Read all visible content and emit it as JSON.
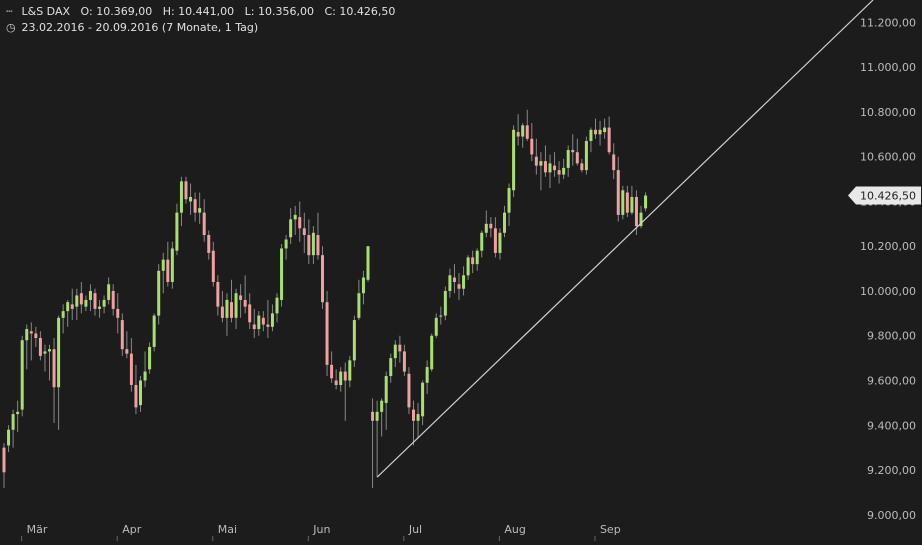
{
  "header": {
    "instrument": "L&S DAX",
    "open_label": "O:",
    "open": "10.369,00",
    "high_label": "H:",
    "high": "10.441,00",
    "low_label": "L:",
    "low": "10.356,00",
    "close_label": "C:",
    "close": "10.426,50",
    "date_range": "23.02.2016 - 20.09.2016 (7 Monate, 1 Tag)",
    "instrument_icon": "candlestick-icon",
    "range_icon": "clock-icon"
  },
  "colors": {
    "background": "#1c1c1c",
    "up": "#a8e070",
    "down": "#f0a0a0",
    "wick": "#888888",
    "trendline": "#d0d0d0",
    "axis_text": "#bbbbbb",
    "price_tag_bg": "#e8e8e8",
    "price_tag_text": "#222222"
  },
  "chart_data": {
    "type": "candlestick",
    "ylim": [
      8950,
      11300
    ],
    "y_ticks": [
      "9.000,00",
      "9.200,00",
      "9.400,00",
      "9.600,00",
      "9.800,00",
      "10.000,00",
      "10.200,00",
      "10.400,00",
      "10.600,00",
      "10.800,00",
      "11.000,00",
      "11.200,00"
    ],
    "y_tick_values": [
      9000,
      9200,
      9400,
      9600,
      9800,
      10000,
      10200,
      10400,
      10600,
      10800,
      11000,
      11200
    ],
    "x_ticks": [
      {
        "label": "Mär",
        "index": 3
      },
      {
        "label": "Apr",
        "index": 24
      },
      {
        "label": "Mai",
        "index": 45
      },
      {
        "label": "Jun",
        "index": 66
      },
      {
        "label": "Jul",
        "index": 87
      },
      {
        "label": "Aug",
        "index": 108
      },
      {
        "label": "Sep",
        "index": 129
      }
    ],
    "last_price_label": "10.426,50",
    "last_price": 10426.5,
    "trendline": {
      "from": {
        "index": 82,
        "value": 9168
      },
      "to": {
        "index": 191,
        "value": 11300
      }
    },
    "candles": [
      [
        9300,
        9320,
        9120,
        9190
      ],
      [
        9310,
        9400,
        9280,
        9380
      ],
      [
        9380,
        9470,
        9300,
        9450
      ],
      [
        9450,
        9510,
        9370,
        9460
      ],
      [
        9470,
        9800,
        9440,
        9780
      ],
      [
        9780,
        9850,
        9650,
        9830
      ],
      [
        9820,
        9860,
        9690,
        9810
      ],
      [
        9810,
        9840,
        9750,
        9790
      ],
      [
        9790,
        9820,
        9690,
        9710
      ],
      [
        9720,
        9760,
        9640,
        9730
      ],
      [
        9730,
        9760,
        9600,
        9740
      ],
      [
        9740,
        9790,
        9410,
        9570
      ],
      [
        9570,
        9890,
        9380,
        9880
      ],
      [
        9880,
        9940,
        9810,
        9910
      ],
      [
        9910,
        9960,
        9840,
        9950
      ],
      [
        9940,
        10010,
        9870,
        9920
      ],
      [
        9930,
        10010,
        9870,
        9980
      ],
      [
        9990,
        10040,
        9900,
        9940
      ],
      [
        9930,
        9980,
        9910,
        9960
      ],
      [
        9960,
        10030,
        9910,
        10000
      ],
      [
        9990,
        10010,
        9890,
        9920
      ],
      [
        9920,
        9960,
        9880,
        9930
      ],
      [
        9930,
        9980,
        9900,
        9960
      ],
      [
        9960,
        10060,
        9940,
        10030
      ],
      [
        10000,
        10030,
        9890,
        9920
      ],
      [
        9920,
        9990,
        9810,
        9880
      ],
      [
        9870,
        9900,
        9710,
        9740
      ],
      [
        9740,
        9820,
        9700,
        9720
      ],
      [
        9720,
        9790,
        9550,
        9580
      ],
      [
        9580,
        9670,
        9450,
        9480
      ],
      [
        9490,
        9620,
        9460,
        9600
      ],
      [
        9600,
        9730,
        9570,
        9640
      ],
      [
        9650,
        9770,
        9630,
        9750
      ],
      [
        9750,
        9900,
        9730,
        9890
      ],
      [
        9890,
        10120,
        9850,
        10090
      ],
      [
        10090,
        10170,
        9990,
        10140
      ],
      [
        10140,
        10220,
        10020,
        10040
      ],
      [
        10040,
        10220,
        10010,
        10190
      ],
      [
        10180,
        10390,
        10160,
        10350
      ],
      [
        10350,
        10510,
        10290,
        10490
      ],
      [
        10490,
        10510,
        10390,
        10410
      ],
      [
        10400,
        10480,
        10340,
        10420
      ],
      [
        10410,
        10440,
        10310,
        10350
      ],
      [
        10350,
        10440,
        10300,
        10370
      ],
      [
        10350,
        10410,
        10220,
        10250
      ],
      [
        10250,
        10270,
        10140,
        10170
      ],
      [
        10180,
        10220,
        10020,
        10040
      ],
      [
        10040,
        10070,
        9890,
        9930
      ],
      [
        9930,
        10000,
        9860,
        9880
      ],
      [
        9880,
        9990,
        9800,
        9960
      ],
      [
        9950,
        10050,
        9860,
        9880
      ],
      [
        9880,
        10010,
        9830,
        9990
      ],
      [
        9980,
        10030,
        9880,
        9960
      ],
      [
        9960,
        10070,
        9900,
        9930
      ],
      [
        9940,
        9990,
        9830,
        9860
      ],
      [
        9850,
        9920,
        9790,
        9830
      ],
      [
        9830,
        9910,
        9800,
        9890
      ],
      [
        9880,
        9910,
        9820,
        9850
      ],
      [
        9850,
        9960,
        9790,
        9840
      ],
      [
        9840,
        9940,
        9820,
        9900
      ],
      [
        9900,
        9990,
        9860,
        9970
      ],
      [
        9960,
        10210,
        9930,
        10190
      ],
      [
        10190,
        10250,
        10140,
        10230
      ],
      [
        10240,
        10370,
        10210,
        10320
      ],
      [
        10320,
        10380,
        10250,
        10340
      ],
      [
        10330,
        10400,
        10220,
        10280
      ],
      [
        10280,
        10350,
        10170,
        10250
      ],
      [
        10250,
        10320,
        10120,
        10160
      ],
      [
        10160,
        10290,
        10120,
        10260
      ],
      [
        10250,
        10350,
        10140,
        10160
      ],
      [
        10160,
        10200,
        9920,
        9950
      ],
      [
        9950,
        10000,
        9620,
        9670
      ],
      [
        9670,
        9730,
        9590,
        9610
      ],
      [
        9600,
        9650,
        9560,
        9580
      ],
      [
        9580,
        9660,
        9550,
        9640
      ],
      [
        9640,
        9680,
        9420,
        9600
      ],
      [
        9600,
        9710,
        9570,
        9690
      ],
      [
        9690,
        9890,
        9660,
        9870
      ],
      [
        9880,
        10050,
        9870,
        9990
      ],
      [
        9990,
        10090,
        9940,
        10060
      ],
      [
        10050,
        10200,
        10040,
        10200
      ],
      [
        9460,
        9520,
        9120,
        9420
      ],
      [
        9420,
        9510,
        9170,
        9460
      ],
      [
        9460,
        9520,
        9350,
        9510
      ],
      [
        9500,
        9640,
        9380,
        9620
      ],
      [
        9620,
        9720,
        9590,
        9700
      ],
      [
        9700,
        9780,
        9660,
        9760
      ],
      [
        9760,
        9800,
        9680,
        9730
      ],
      [
        9730,
        9760,
        9620,
        9640
      ],
      [
        9630,
        9660,
        9450,
        9480
      ],
      [
        9470,
        9510,
        9310,
        9420
      ],
      [
        9420,
        9500,
        9340,
        9450
      ],
      [
        9440,
        9600,
        9400,
        9590
      ],
      [
        9590,
        9690,
        9540,
        9660
      ],
      [
        9650,
        9810,
        9640,
        9800
      ],
      [
        9800,
        9900,
        9790,
        9880
      ],
      [
        9890,
        9930,
        9850,
        9890
      ],
      [
        9890,
        10020,
        9870,
        10000
      ],
      [
        10000,
        10100,
        9970,
        10070
      ],
      [
        10060,
        10120,
        9990,
        10040
      ],
      [
        10030,
        10080,
        9960,
        10010
      ],
      [
        10010,
        10110,
        9980,
        10070
      ],
      [
        10070,
        10160,
        10050,
        10150
      ],
      [
        10150,
        10180,
        10080,
        10120
      ],
      [
        10120,
        10190,
        10090,
        10180
      ],
      [
        10180,
        10270,
        10150,
        10260
      ],
      [
        10260,
        10360,
        10240,
        10300
      ],
      [
        10300,
        10330,
        10240,
        10280
      ],
      [
        10280,
        10330,
        10150,
        10170
      ],
      [
        10170,
        10280,
        10140,
        10260
      ],
      [
        10260,
        10380,
        10240,
        10350
      ],
      [
        10350,
        10480,
        10290,
        10460
      ],
      [
        10450,
        10740,
        10420,
        10720
      ],
      [
        10710,
        10790,
        10650,
        10690
      ],
      [
        10690,
        10750,
        10640,
        10740
      ],
      [
        10740,
        10810,
        10670,
        10680
      ],
      [
        10680,
        10750,
        10580,
        10610
      ],
      [
        10600,
        10680,
        10520,
        10560
      ],
      [
        10560,
        10620,
        10450,
        10580
      ],
      [
        10580,
        10650,
        10510,
        10530
      ],
      [
        10530,
        10610,
        10460,
        10570
      ],
      [
        10560,
        10620,
        10510,
        10540
      ],
      [
        10540,
        10580,
        10480,
        10520
      ],
      [
        10520,
        10590,
        10500,
        10550
      ],
      [
        10550,
        10650,
        10510,
        10630
      ],
      [
        10630,
        10700,
        10560,
        10620
      ],
      [
        10620,
        10680,
        10560,
        10570
      ],
      [
        10570,
        10590,
        10530,
        10540
      ],
      [
        10540,
        10690,
        10520,
        10670
      ],
      [
        10670,
        10730,
        10620,
        10720
      ],
      [
        10720,
        10770,
        10680,
        10700
      ],
      [
        10700,
        10760,
        10650,
        10720
      ],
      [
        10710,
        10770,
        10680,
        10730
      ],
      [
        10730,
        10780,
        10610,
        10620
      ],
      [
        10610,
        10660,
        10500,
        10540
      ],
      [
        10540,
        10600,
        10310,
        10340
      ],
      [
        10340,
        10470,
        10320,
        10450
      ],
      [
        10440,
        10470,
        10330,
        10350
      ],
      [
        10350,
        10470,
        10340,
        10420
      ],
      [
        10420,
        10450,
        10250,
        10290
      ],
      [
        10290,
        10380,
        10280,
        10350
      ],
      [
        10369,
        10441,
        10356,
        10426.5
      ]
    ]
  }
}
